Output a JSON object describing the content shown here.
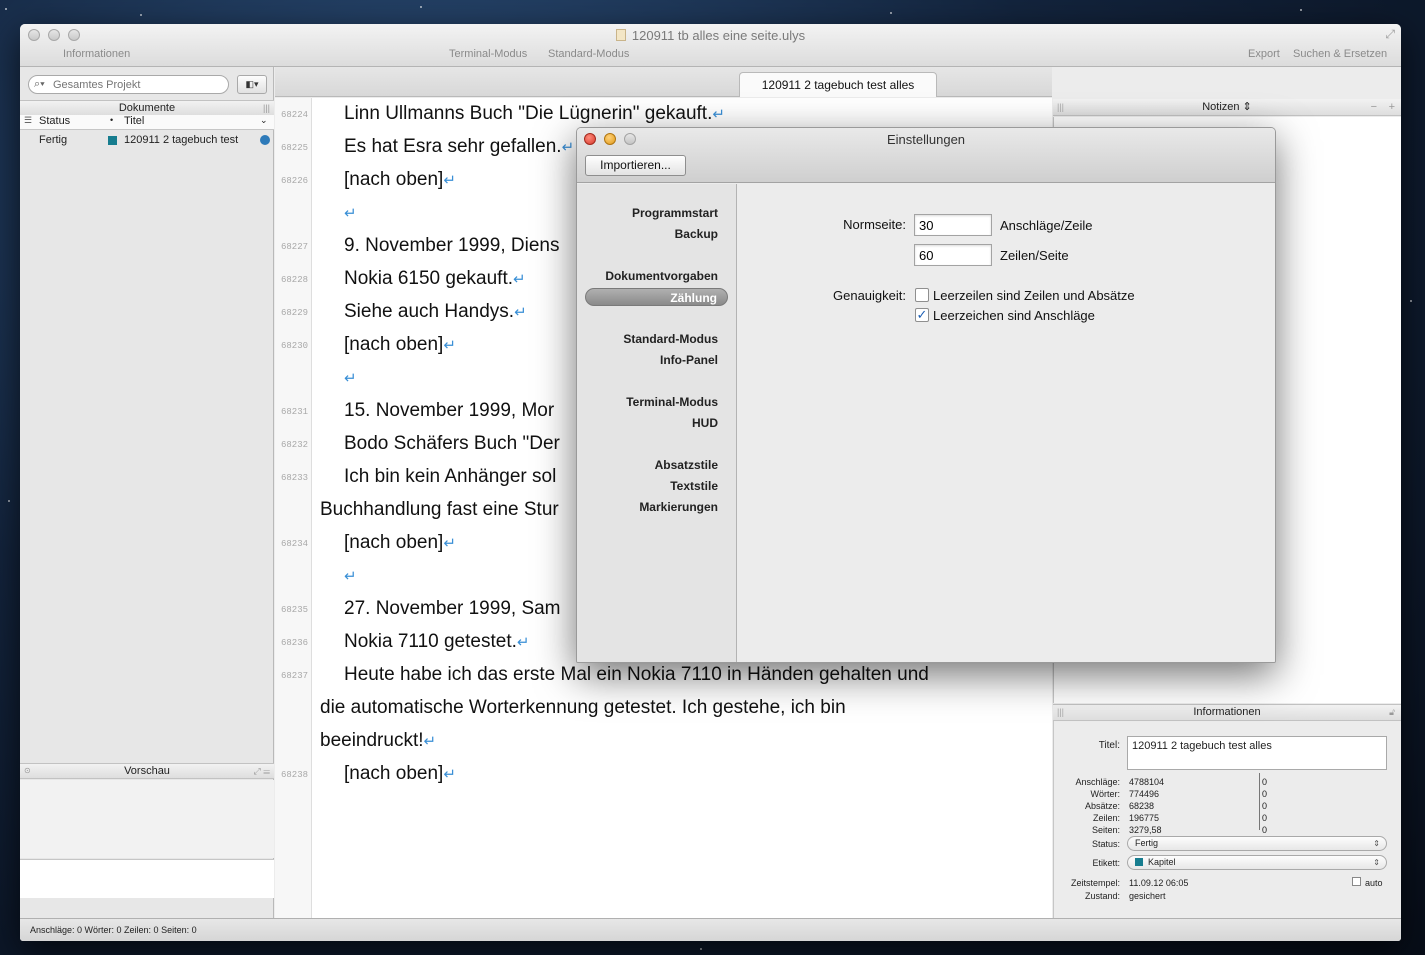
{
  "window": {
    "title": "120911 tb alles eine seite.ulys",
    "toolbar_left": "Informationen",
    "toolbar_center": [
      "Terminal-Modus",
      "Standard-Modus"
    ],
    "toolbar_right": [
      "Export",
      "Suchen & Ersetzen"
    ]
  },
  "sidebar": {
    "search_placeholder": "Gesamtes Projekt",
    "view_button": "▾",
    "documents_header": "Dokumente",
    "columns": {
      "status": "Status",
      "title": "Titel"
    },
    "rows": [
      {
        "status": "Fertig",
        "title": "120911 2 tagebuch test",
        "label_color": "#177d8f",
        "status_color": "#2d7ab9"
      }
    ],
    "preview_header": "Vorschau"
  },
  "editor": {
    "tab": "120911 2 tagebuch test alles",
    "lines": [
      {
        "num": "68224",
        "text": "Linn Ullmanns Buch \"Die Lügnerin\" gekauft."
      },
      {
        "num": "68225",
        "text": "Es hat Esra sehr gefallen."
      },
      {
        "num": "68226",
        "text": "[nach oben]"
      },
      {
        "num": "",
        "text": ""
      },
      {
        "num": "68227",
        "text": "9. November 1999, Diens"
      },
      {
        "num": "68228",
        "text": "Nokia 6150 gekauft."
      },
      {
        "num": "68229",
        "text": "Siehe auch Handys."
      },
      {
        "num": "68230",
        "text": "[nach oben]"
      },
      {
        "num": "",
        "text": ""
      },
      {
        "num": "68231",
        "text": "15. November 1999, Mor"
      },
      {
        "num": "68232",
        "text": "Bodo Schäfers Buch \"Der"
      },
      {
        "num": "68233",
        "text": "Ich bin kein Anhänger sol"
      },
      {
        "num": "",
        "text": "Buchhandlung fast eine Stur"
      },
      {
        "num": "68234",
        "text": "[nach oben]"
      },
      {
        "num": "",
        "text": ""
      },
      {
        "num": "68235",
        "text": "27. November 1999, Sam"
      },
      {
        "num": "68236",
        "text": "Nokia 7110 getestet."
      },
      {
        "num": "68237",
        "text": "Heute habe ich das erste Mal ein Nokia 7110 in Händen gehalten und"
      },
      {
        "num": "",
        "text": "die automatische Worterkennung getestet. Ich gestehe, ich bin"
      },
      {
        "num": "",
        "text": "beeindruckt!"
      },
      {
        "num": "68238",
        "text": "[nach oben]"
      }
    ]
  },
  "notes": {
    "header": "Notizen ⇕"
  },
  "info": {
    "header": "Informationen",
    "title_label": "Titel:",
    "title_value": "120911 2 tagebuch test alles",
    "stats": [
      {
        "label": "Anschläge:",
        "value": "4788104",
        "extra": "0"
      },
      {
        "label": "Wörter:",
        "value": "774496",
        "extra": "0"
      },
      {
        "label": "Absätze:",
        "value": "68238",
        "extra": "0"
      },
      {
        "label": "Zeilen:",
        "value": "196775",
        "extra": "0"
      },
      {
        "label": "Seiten:",
        "value": "3279,58",
        "extra": "0"
      }
    ],
    "status_label": "Status:",
    "status_value": "Fertig",
    "label_label": "Etikett:",
    "label_value": "Kapitel",
    "label_color": "#177d8f",
    "timestamp_label": "Zeitstempel:",
    "timestamp_value": "11.09.12 06:05",
    "auto_label": "auto",
    "state_label": "Zustand:",
    "state_value": "gesichert"
  },
  "statusbar": {
    "text": "Anschläge: 0  Wörter: 0  Zeilen: 0  Seiten: 0"
  },
  "dialog": {
    "title": "Einstellungen",
    "import_button": "Importieren...",
    "nav": [
      {
        "label": "Programmstart",
        "selected": false
      },
      {
        "label": "Backup",
        "selected": false
      },
      {
        "label": "Dokumentvorgaben",
        "selected": false
      },
      {
        "label": "Zählung",
        "selected": true
      },
      {
        "label": "Standard-Modus",
        "selected": false
      },
      {
        "label": "Info-Panel",
        "selected": false
      },
      {
        "label": "Terminal-Modus",
        "selected": false
      },
      {
        "label": "HUD",
        "selected": false
      },
      {
        "label": "Absatzstile",
        "selected": false
      },
      {
        "label": "Textstile",
        "selected": false
      },
      {
        "label": "Markierungen",
        "selected": false
      }
    ],
    "normseite_label": "Normseite:",
    "chars_per_line": "30",
    "chars_per_line_unit": "Anschläge/Zeile",
    "lines_per_page": "60",
    "lines_per_page_unit": "Zeilen/Seite",
    "accuracy_label": "Genauigkeit:",
    "option1": "Leerzeilen sind Zeilen und Absätze",
    "option1_checked": false,
    "option2": "Leerzeichen sind Anschläge",
    "option2_checked": true
  }
}
